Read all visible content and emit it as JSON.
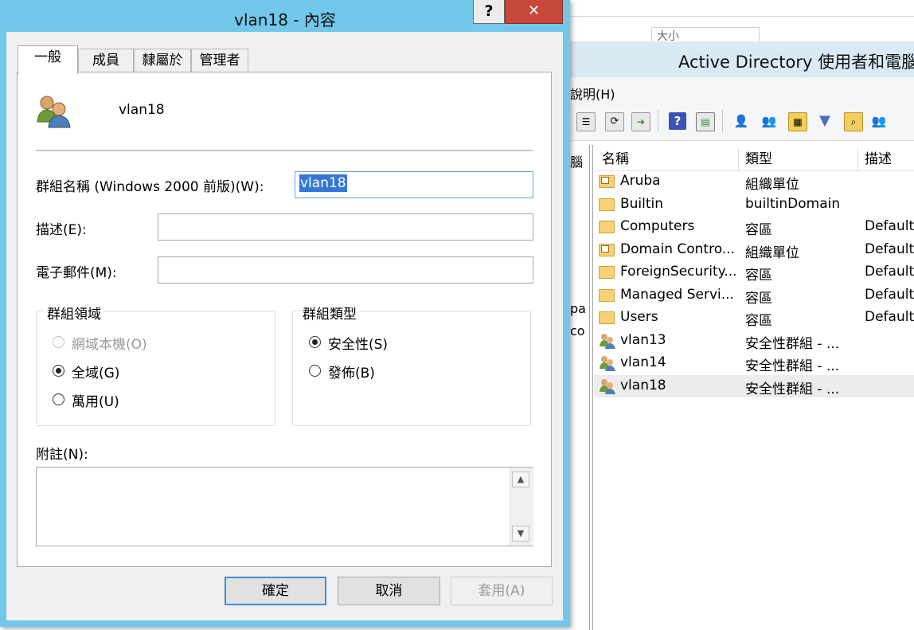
{
  "background_window": {
    "title": "Active Directory 使用者和電腦",
    "partial_tab_text": "大小",
    "menu_help": "說明(H)",
    "left_pane_fragments": [
      "腦",
      "pa",
      "co"
    ],
    "columns": [
      "名稱",
      "類型",
      "描述"
    ],
    "rows": [
      {
        "name": "Aruba",
        "type": "組織單位",
        "desc": "",
        "icon": "ou-folder-icon"
      },
      {
        "name": "Builtin",
        "type": "builtinDomain",
        "desc": "",
        "icon": "builtin-folder-icon"
      },
      {
        "name": "Computers",
        "type": "容區",
        "desc": "Default",
        "icon": "container-folder-icon"
      },
      {
        "name": "Domain Contro...",
        "type": "組織單位",
        "desc": "Default",
        "icon": "ou-folder-icon"
      },
      {
        "name": "ForeignSecurity...",
        "type": "容區",
        "desc": "Default",
        "icon": "container-folder-icon"
      },
      {
        "name": "Managed Servi...",
        "type": "容區",
        "desc": "Default",
        "icon": "container-folder-icon"
      },
      {
        "name": "Users",
        "type": "容區",
        "desc": "Default",
        "icon": "container-folder-icon"
      },
      {
        "name": "vlan13",
        "type": "安全性群組 - ...",
        "desc": "",
        "icon": "group-icon"
      },
      {
        "name": "vlan14",
        "type": "安全性群組 - ...",
        "desc": "",
        "icon": "group-icon"
      },
      {
        "name": "vlan18",
        "type": "安全性群組 - ...",
        "desc": "",
        "icon": "group-icon",
        "selected": true
      }
    ]
  },
  "dialog": {
    "title": "vlan18 - 內容",
    "help_label": "?",
    "close_label": "✕",
    "tabs": [
      "一般",
      "成員",
      "隸屬於",
      "管理者"
    ],
    "active_tab": "一般",
    "group_name": "vlan18",
    "prewin_label": "群組名稱 (Windows 2000 前版)(W):",
    "prewin_value": "vlan18",
    "description_label": "描述(E):",
    "description_value": "",
    "email_label": "電子郵件(M):",
    "email_value": "",
    "scope": {
      "title": "群組領域",
      "options": [
        {
          "label": "網域本機(O)",
          "checked": false,
          "disabled": true
        },
        {
          "label": "全域(G)",
          "checked": true,
          "disabled": false
        },
        {
          "label": "萬用(U)",
          "checked": false,
          "disabled": false
        }
      ]
    },
    "type": {
      "title": "群組類型",
      "options": [
        {
          "label": "安全性(S)",
          "checked": true
        },
        {
          "label": "發佈(B)",
          "checked": false
        }
      ]
    },
    "notes_label": "附註(N):",
    "notes_value": "",
    "buttons": {
      "ok": "確定",
      "cancel": "取消",
      "apply": "套用(A)"
    }
  }
}
